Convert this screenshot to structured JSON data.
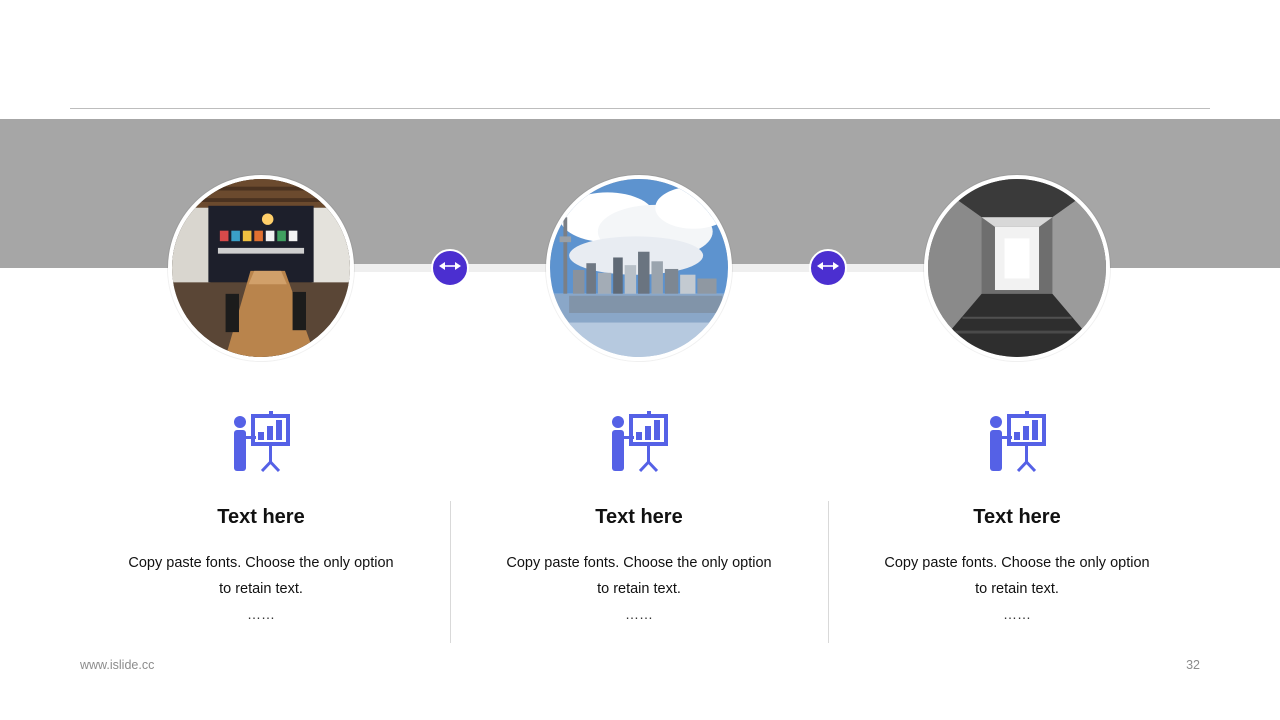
{
  "colors": {
    "accent": "#4b2fd0",
    "icon": "#5561e6",
    "band": "#a6a6a6"
  },
  "cards": [
    {
      "photo": "meeting-room-photo",
      "icon": "presentation-chart-icon",
      "title": "Text here",
      "text_line1": "Copy paste fonts. Choose the only option",
      "text_line2": "to retain text.",
      "dots": "……"
    },
    {
      "photo": "city-skyline-photo",
      "icon": "presentation-chart-icon",
      "title": "Text here",
      "text_line1": "Copy paste fonts. Choose the only option",
      "text_line2": "to retain text.",
      "dots": "……"
    },
    {
      "photo": "concrete-corridor-photo",
      "icon": "presentation-chart-icon",
      "title": "Text here",
      "text_line1": "Copy paste fonts. Choose the only option",
      "text_line2": "to retain text.",
      "dots": "……"
    }
  ],
  "connectors": [
    {
      "icon": "double-arrow-icon"
    },
    {
      "icon": "double-arrow-icon"
    }
  ],
  "footer": {
    "url": "www.islide.cc",
    "page_number": "32"
  }
}
